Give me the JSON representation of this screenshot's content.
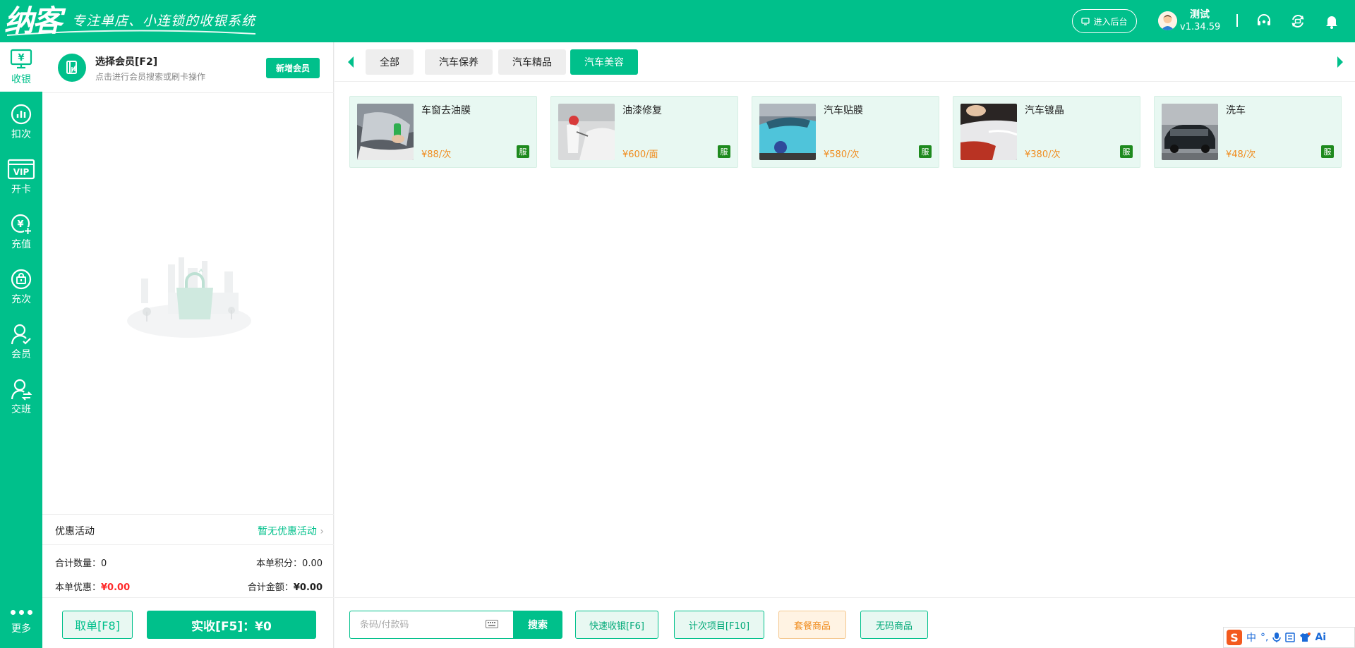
{
  "header": {
    "logo": "纳客",
    "slogan": "专注单店、小连锁的收银系统",
    "backend_button": "进入后台",
    "user_name": "测试",
    "version": "v1.34.59"
  },
  "leftnav": {
    "items": [
      {
        "label": "收银",
        "icon": "cash-register-icon"
      },
      {
        "label": "扣次",
        "icon": "chart-icon"
      },
      {
        "label": "开卡",
        "icon": "vip-card-icon"
      },
      {
        "label": "充值",
        "icon": "recharge-icon"
      },
      {
        "label": "充次",
        "icon": "bag-icon"
      },
      {
        "label": "会员",
        "icon": "member-icon"
      },
      {
        "label": "交班",
        "icon": "shift-icon"
      }
    ],
    "more_label": "更多"
  },
  "member": {
    "title": "选择会员[F2]",
    "subtitle": "点击进行会员搜索或刷卡操作",
    "new_button": "新增会员"
  },
  "promo": {
    "label": "优惠活动",
    "value": "暂无优惠活动"
  },
  "summary": {
    "qty_label": "合计数量：",
    "qty_value": "0",
    "points_label": "本单积分：",
    "points_value": "0.00",
    "discount_label": "本单优惠：",
    "discount_value": "¥0.00",
    "total_label": "合计金额：",
    "total_value": "¥0.00"
  },
  "actions_left": {
    "cancel": "取单[F8]",
    "pay": "实收[F5]：¥0"
  },
  "tabs": [
    {
      "label": "全部",
      "active": false
    },
    {
      "label": "汽车保养",
      "active": false
    },
    {
      "label": "汽车精品",
      "active": false
    },
    {
      "label": "汽车美容",
      "active": true
    }
  ],
  "products": [
    {
      "name": "车窗去油膜",
      "price": "¥88/次",
      "tag": "服"
    },
    {
      "name": "油漆修复",
      "price": "¥600/面",
      "tag": "服"
    },
    {
      "name": "汽车贴膜",
      "price": "¥580/次",
      "tag": "服"
    },
    {
      "name": "汽车镀晶",
      "price": "¥380/次",
      "tag": "服"
    },
    {
      "name": "洗车",
      "price": "¥48/次",
      "tag": "服"
    }
  ],
  "search": {
    "placeholder": "条码/付款码",
    "button": "搜索"
  },
  "bottom_actions": {
    "quick_pay": "快速收银[F6]",
    "count_item": "计次项目[F10]",
    "package": "套餐商品",
    "no_code": "无码商品"
  },
  "ime": {
    "lang": "中",
    "ai": "Ai"
  },
  "colors": {
    "brand": "#00c08b",
    "price": "#f08c1e",
    "discount": "#ff2a2a"
  }
}
